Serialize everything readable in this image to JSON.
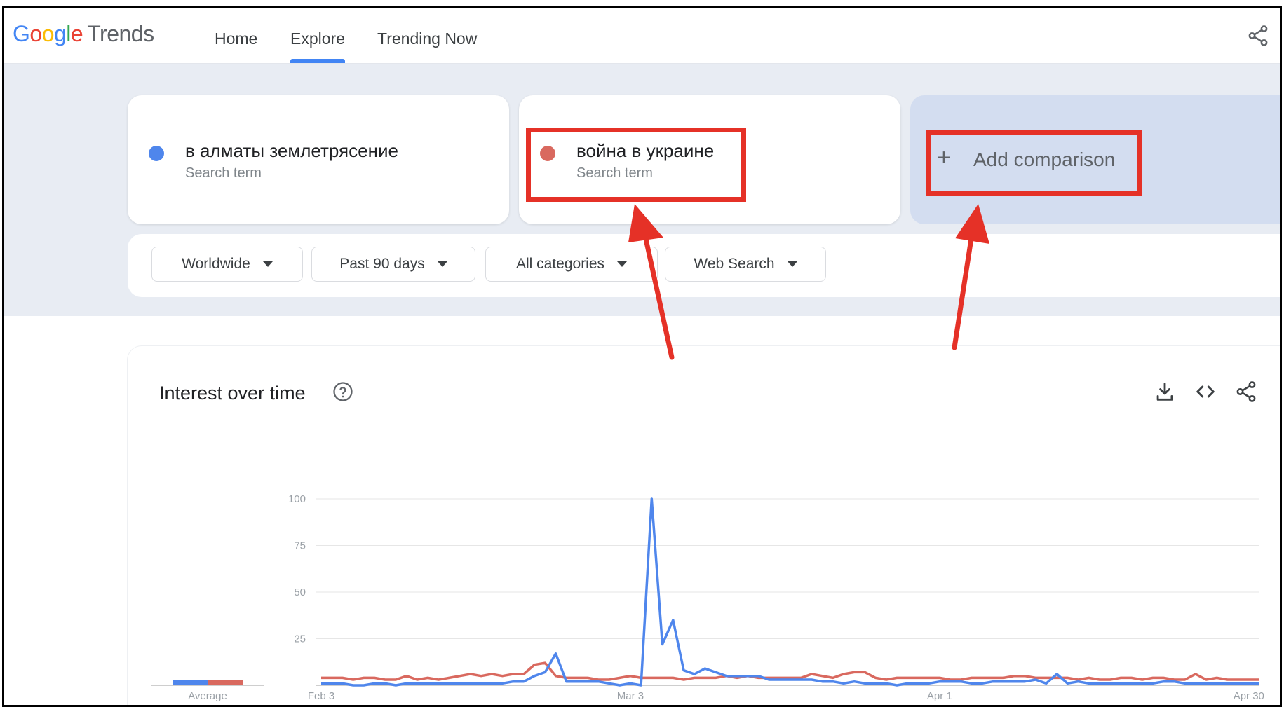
{
  "header": {
    "logo_google": [
      "G",
      "o",
      "o",
      "g",
      "l",
      "e"
    ],
    "logo_trends": "Trends",
    "nav": [
      {
        "label": "Home"
      },
      {
        "label": "Explore",
        "active": true
      },
      {
        "label": "Trending Now"
      }
    ],
    "share_icon": "share-icon"
  },
  "terms": [
    {
      "title": "в алматы землетрясение",
      "subtitle": "Search term",
      "color": "#4f86ec"
    },
    {
      "title": "война в украине",
      "subtitle": "Search term",
      "color": "#d9695f"
    }
  ],
  "add_comparison": {
    "label": "Add comparison",
    "icon": "plus-icon"
  },
  "filters": [
    {
      "label": "Worldwide"
    },
    {
      "label": "Past 90 days"
    },
    {
      "label": "All categories"
    },
    {
      "label": "Web Search"
    }
  ],
  "annotation": {
    "highlight_color": "#e53127"
  },
  "chart_section": {
    "title": "Interest over time",
    "help_icon": "help-circle-icon",
    "tools": [
      "download-icon",
      "embed-code-icon",
      "share-icon"
    ]
  },
  "chart_data": {
    "type": "line",
    "ylim": [
      0,
      100
    ],
    "yticks": [
      25,
      50,
      75,
      100
    ],
    "xticks": [
      "Feb 3",
      "Mar 3",
      "Apr 1",
      "Apr 30"
    ],
    "average_label": "Average",
    "averages": [
      {
        "series": "в алматы землетрясение",
        "value": 3,
        "color": "#4f86ec"
      },
      {
        "series": "война в украине",
        "value": 3,
        "color": "#d9695f"
      }
    ],
    "x": [
      "Feb 3",
      "Feb 4",
      "Feb 5",
      "Feb 6",
      "Feb 7",
      "Feb 8",
      "Feb 9",
      "Feb 10",
      "Feb 11",
      "Feb 12",
      "Feb 13",
      "Feb 14",
      "Feb 15",
      "Feb 16",
      "Feb 17",
      "Feb 18",
      "Feb 19",
      "Feb 20",
      "Feb 21",
      "Feb 22",
      "Feb 23",
      "Feb 24",
      "Feb 25",
      "Feb 26",
      "Feb 27",
      "Feb 28",
      "Feb 29",
      "Mar 1",
      "Mar 2",
      "Mar 3",
      "Mar 4",
      "Mar 5",
      "Mar 6",
      "Mar 7",
      "Mar 8",
      "Mar 9",
      "Mar 10",
      "Mar 11",
      "Mar 12",
      "Mar 13",
      "Mar 14",
      "Mar 15",
      "Mar 16",
      "Mar 17",
      "Mar 18",
      "Mar 19",
      "Mar 20",
      "Mar 21",
      "Mar 22",
      "Mar 23",
      "Mar 24",
      "Mar 25",
      "Mar 26",
      "Mar 27",
      "Mar 28",
      "Mar 29",
      "Mar 30",
      "Mar 31",
      "Apr 1",
      "Apr 2",
      "Apr 3",
      "Apr 4",
      "Apr 5",
      "Apr 6",
      "Apr 7",
      "Apr 8",
      "Apr 9",
      "Apr 10",
      "Apr 11",
      "Apr 12",
      "Apr 13",
      "Apr 14",
      "Apr 15",
      "Apr 16",
      "Apr 17",
      "Apr 18",
      "Apr 19",
      "Apr 20",
      "Apr 21",
      "Apr 22",
      "Apr 23",
      "Apr 24",
      "Apr 25",
      "Apr 26",
      "Apr 27",
      "Apr 28",
      "Apr 29",
      "Apr 30",
      "May 1"
    ],
    "series": [
      {
        "name": "в алматы землетрясение",
        "color": "#4f86ec",
        "values": [
          1,
          1,
          1,
          0,
          0,
          1,
          1,
          0,
          1,
          1,
          1,
          1,
          1,
          1,
          1,
          1,
          1,
          1,
          2,
          2,
          5,
          7,
          17,
          2,
          2,
          2,
          2,
          1,
          0,
          1,
          0,
          100,
          22,
          35,
          8,
          6,
          9,
          7,
          5,
          5,
          5,
          5,
          3,
          3,
          3,
          3,
          3,
          2,
          2,
          1,
          2,
          1,
          1,
          1,
          0,
          1,
          1,
          1,
          2,
          2,
          2,
          1,
          1,
          2,
          2,
          2,
          2,
          3,
          1,
          6,
          1,
          2,
          1,
          1,
          1,
          1,
          1,
          1,
          1,
          2,
          2,
          1,
          1,
          1,
          1,
          1,
          1,
          1,
          1
        ]
      },
      {
        "name": "война в украине",
        "color": "#d9695f",
        "values": [
          4,
          4,
          4,
          3,
          4,
          4,
          3,
          3,
          5,
          3,
          4,
          3,
          4,
          5,
          6,
          5,
          6,
          5,
          6,
          6,
          11,
          12,
          5,
          4,
          4,
          4,
          3,
          3,
          4,
          5,
          4,
          4,
          4,
          4,
          3,
          4,
          4,
          4,
          5,
          4,
          5,
          4,
          4,
          4,
          4,
          4,
          6,
          5,
          4,
          6,
          7,
          7,
          4,
          3,
          4,
          4,
          4,
          4,
          4,
          3,
          3,
          4,
          4,
          4,
          4,
          5,
          5,
          4,
          4,
          4,
          4,
          3,
          4,
          3,
          3,
          4,
          4,
          3,
          4,
          4,
          3,
          3,
          6,
          3,
          4,
          3,
          3,
          3,
          3
        ]
      }
    ]
  }
}
